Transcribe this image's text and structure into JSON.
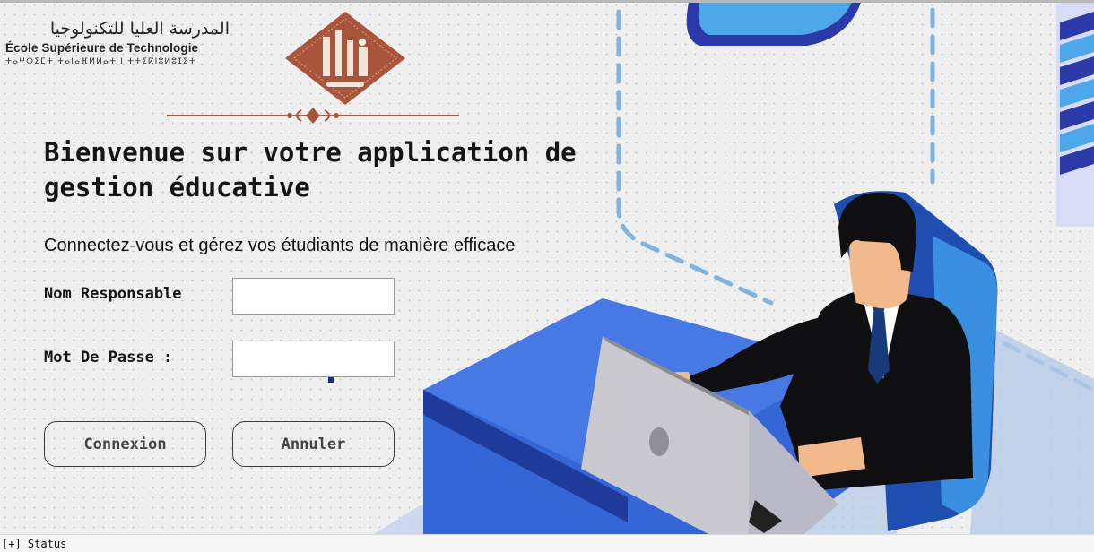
{
  "header": {
    "school_arabic": "المدرسة العليا للتكنولوجيا",
    "school_french": "École Supérieure de Technologie",
    "school_tifinagh": "ⵜⴰⵖⵔⵉⵎⵜ ⵜⴰⵏⴰⴼⵍⵍⴰⵜ ⵏ ⵜⵜⵉⴽⵏⵓⵍⵓⵊⵉⵜ"
  },
  "welcome": {
    "title": "Bienvenue sur votre application de gestion éducative",
    "subtitle": "Connectez-vous et gérez vos étudiants de manière efficace"
  },
  "form": {
    "username_label": "Nom Responsable",
    "username_value": "",
    "password_label": "Mot De Passe :",
    "password_value": ""
  },
  "buttons": {
    "login": "Connexion",
    "cancel": "Annuler"
  },
  "status": {
    "toggle": "[+]",
    "label": "Status"
  },
  "colors": {
    "logo_brown": "#a8553b",
    "accent_blue": "#2b3aa8",
    "light_blue": "#4da7e8"
  },
  "icons": {
    "logo": "school-emblem-icon",
    "ornament": "divider-ornament-icon"
  }
}
